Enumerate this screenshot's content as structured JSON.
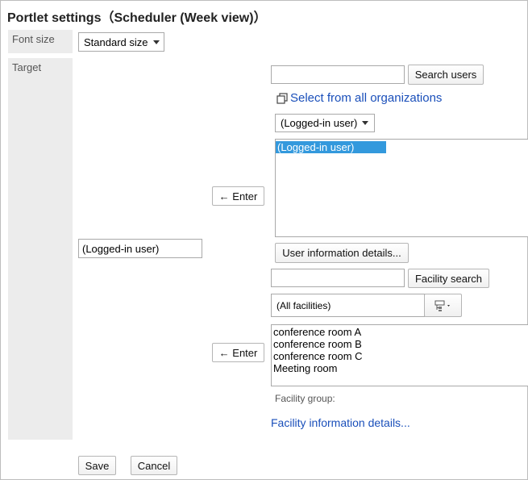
{
  "title": "Portlet settings（Scheduler (Week view)）",
  "font_size": {
    "label": "Font size",
    "value": "Standard size"
  },
  "target": {
    "label": "Target",
    "current_value": "(Logged-in user)",
    "users": {
      "search_input_value": "",
      "search_button": "Search users",
      "select_all_orgs_link": "Select from all organizations",
      "org_dropdown": "(Logged-in user)",
      "list_options": [
        "(Logged-in user)"
      ],
      "selected_option": "(Logged-in user)",
      "enter_button": "← Enter",
      "details_button": "User information details..."
    },
    "facilities": {
      "search_input_value": "",
      "search_button": "Facility search",
      "group_dropdown": "(All facilities)",
      "list_options": [
        "conference room A",
        "conference room B",
        "conference room C",
        "Meeting room"
      ],
      "enter_button": "← Enter",
      "facility_group_label": "Facility group:",
      "details_link": "Facility information details..."
    }
  },
  "actions": {
    "save": "Save",
    "cancel": "Cancel"
  },
  "colors": {
    "label_bg": "#ececec",
    "link": "#1a4fba",
    "selected_bg": "#3399dd"
  }
}
